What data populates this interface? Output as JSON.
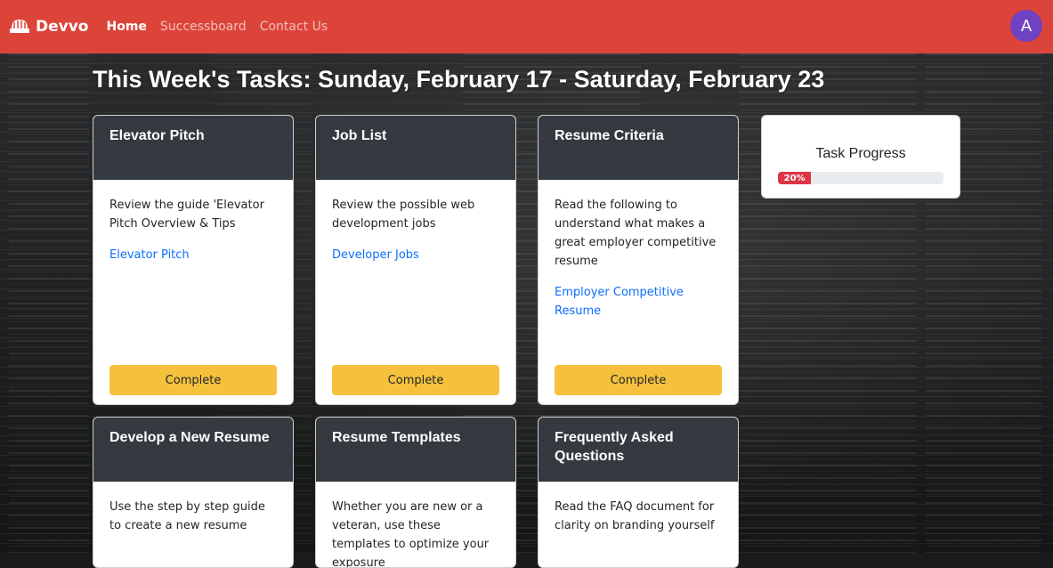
{
  "app": {
    "brand": "Devvo"
  },
  "nav": {
    "links": [
      {
        "label": "Home",
        "active": true
      },
      {
        "label": "Successboard",
        "active": false
      },
      {
        "label": "Contact Us",
        "active": false
      }
    ],
    "avatar_initial": "A"
  },
  "page": {
    "title": "This Week's Tasks: Sunday, February 17 - Saturday, February 23"
  },
  "cards": [
    {
      "title": "Elevator Pitch",
      "description": "Review the guide 'Elevator Pitch Overview & Tips",
      "link": "Elevator Pitch",
      "button": "Complete"
    },
    {
      "title": "Job List",
      "description": "Review the possible web development jobs",
      "link": "Developer Jobs",
      "button": "Complete"
    },
    {
      "title": "Resume Criteria",
      "description": "Read the following to understand what makes a great employer competitive resume",
      "link": "Employer Competitive Resume",
      "button": "Complete"
    },
    {
      "title": "Develop a New Resume",
      "description": "Use the step by step guide to create a new resume"
    },
    {
      "title": "Resume Templates",
      "description": "Whether you are new or a veteran, use these templates to optimize your exposure"
    },
    {
      "title": "Frequently Asked Questions",
      "description": "Read the FAQ document for clarity on branding yourself"
    }
  ],
  "progress": {
    "title": "Task Progress",
    "value_label": "20%",
    "fraction": 0.2
  },
  "colors": {
    "navbar": "#dd4439",
    "card_header": "#343a40",
    "button": "#f5c13d",
    "link": "#0d6efd",
    "progress_fill": "#dc3545",
    "avatar": "#6f42c1"
  }
}
